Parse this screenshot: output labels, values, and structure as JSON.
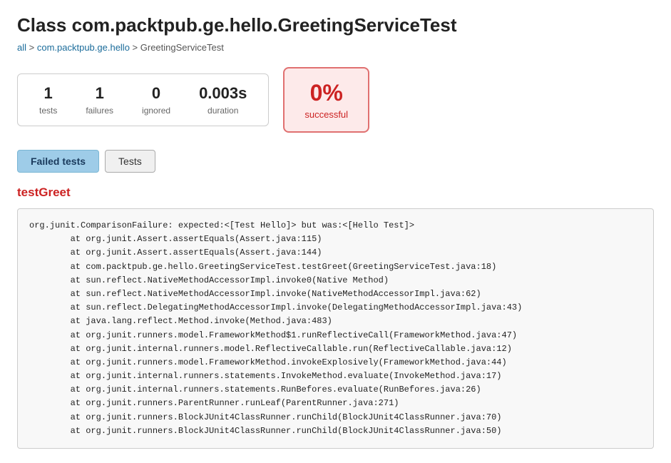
{
  "page": {
    "title": "Class com.packtpub.ge.hello.GreetingServiceTest",
    "breadcrumb": {
      "all": "all",
      "separator1": " > ",
      "package": "com.packtpub.ge.hello",
      "separator2": " > ",
      "current": "GreetingServiceTest"
    }
  },
  "stats": {
    "tests_value": "1",
    "tests_label": "tests",
    "failures_value": "1",
    "failures_label": "failures",
    "ignored_value": "0",
    "ignored_label": "ignored",
    "duration_value": "0.003s",
    "duration_label": "duration"
  },
  "success": {
    "percent": "0%",
    "label": "successful"
  },
  "tabs": [
    {
      "id": "failed-tests",
      "label": "Failed tests",
      "active": true
    },
    {
      "id": "tests",
      "label": "Tests",
      "active": false
    }
  ],
  "failed_test": {
    "name": "testGreet",
    "stacktrace": "org.junit.ComparisonFailure: expected:<[Test Hello]> but was:<[Hello Test]>\n        at org.junit.Assert.assertEquals(Assert.java:115)\n        at org.junit.Assert.assertEquals(Assert.java:144)\n        at com.packtpub.ge.hello.GreetingServiceTest.testGreet(GreetingServiceTest.java:18)\n        at sun.reflect.NativeMethodAccessorImpl.invoke0(Native Method)\n        at sun.reflect.NativeMethodAccessorImpl.invoke(NativeMethodAccessorImpl.java:62)\n        at sun.reflect.DelegatingMethodAccessorImpl.invoke(DelegatingMethodAccessorImpl.java:43)\n        at java.lang.reflect.Method.invoke(Method.java:483)\n        at org.junit.runners.model.FrameworkMethod$1.runReflectiveCall(FrameworkMethod.java:47)\n        at org.junit.internal.runners.model.ReflectiveCallable.run(ReflectiveCallable.java:12)\n        at org.junit.runners.model.FrameworkMethod.invokeExplosively(FrameworkMethod.java:44)\n        at org.junit.internal.runners.statements.InvokeMethod.evaluate(InvokeMethod.java:17)\n        at org.junit.internal.runners.statements.RunBefores.evaluate(RunBefores.java:26)\n        at org.junit.runners.ParentRunner.runLeaf(ParentRunner.java:271)\n        at org.junit.runners.BlockJUnit4ClassRunner.runChild(BlockJUnit4ClassRunner.java:70)\n        at org.junit.runners.BlockJUnit4ClassRunner.runChild(BlockJUnit4ClassRunner.java:50)"
  }
}
